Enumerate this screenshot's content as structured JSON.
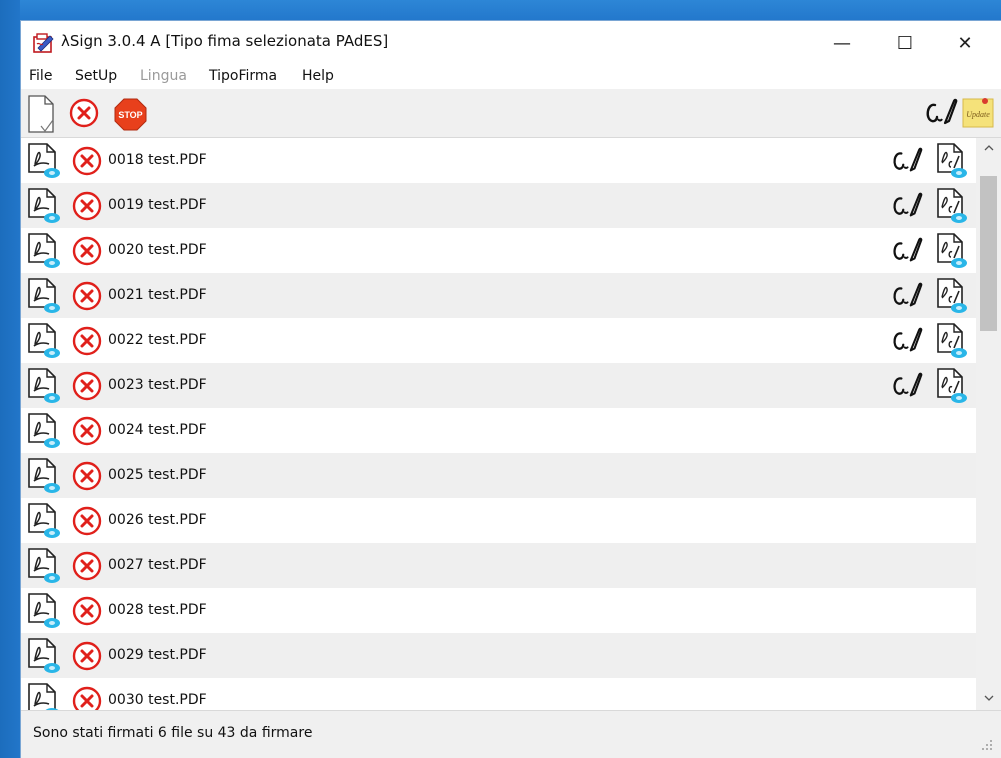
{
  "window": {
    "title": "λSign  3.0.4 A  [Tipo fima selezionata PAdES]",
    "controls": {
      "minimize": "—",
      "maximize": "☐",
      "close": "✕"
    }
  },
  "menu": [
    "File",
    "SetUp",
    "Lingua",
    "TipoFirma",
    "Help"
  ],
  "menu_disabled": [
    "Lingua"
  ],
  "toolbar": {
    "left_icons": [
      "new-document-icon",
      "cancel-icon",
      "stop-icon"
    ],
    "stop_label": "STOP",
    "right_icons": [
      "signature-icon",
      "sticky-note-icon"
    ],
    "note_label": "Update"
  },
  "files": [
    {
      "name": "0018 test.PDF",
      "signed": true
    },
    {
      "name": "0019 test.PDF",
      "signed": true
    },
    {
      "name": "0020 test.PDF",
      "signed": true
    },
    {
      "name": "0021 test.PDF",
      "signed": true
    },
    {
      "name": "0022 test.PDF",
      "signed": true
    },
    {
      "name": "0023 test.PDF",
      "signed": true
    },
    {
      "name": "0024 test.PDF",
      "signed": false
    },
    {
      "name": "0025 test.PDF",
      "signed": false
    },
    {
      "name": "0026 test.PDF",
      "signed": false
    },
    {
      "name": "0027 test.PDF",
      "signed": false
    },
    {
      "name": "0028 test.PDF",
      "signed": false
    },
    {
      "name": "0029 test.PDF",
      "signed": false
    },
    {
      "name": "0030 test.PDF",
      "signed": false
    }
  ],
  "status": "Sono stati firmati 6 file su 43 da firmare",
  "colors": {
    "cancel_red": "#e0201b",
    "stop_red": "#e8401c",
    "pdf_badge": "#29b6e8",
    "row_alt": "#efefef",
    "note_yellow": "#f5e27a"
  }
}
